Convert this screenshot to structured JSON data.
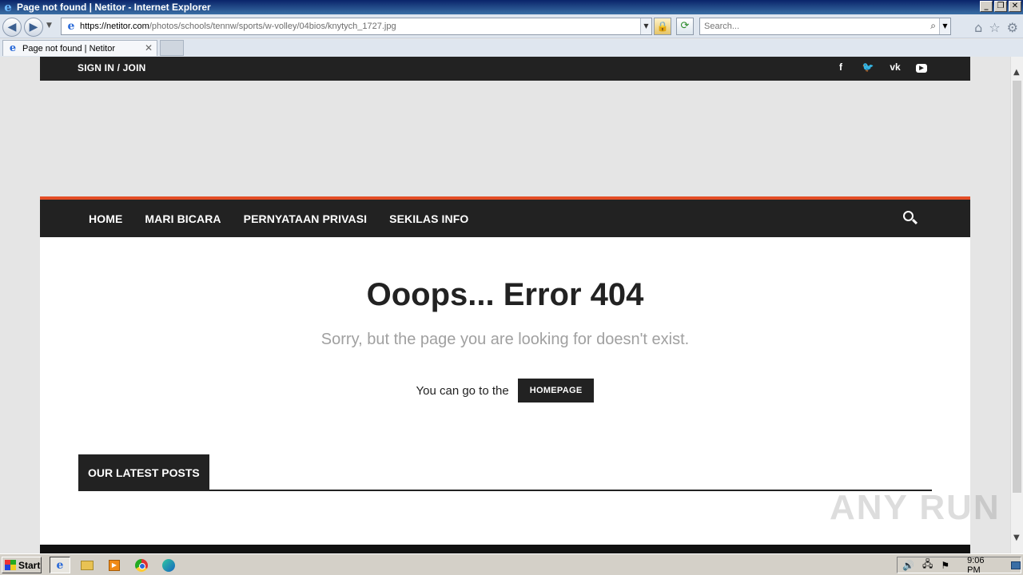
{
  "window": {
    "title": "Page not found | Netitor - Internet Explorer",
    "buttons": [
      "_",
      "❐",
      "✕"
    ]
  },
  "address_bar": {
    "url_host": "https://netitor.com",
    "url_path": "/photos/schools/tennw/sports/w-volley/04bios/knytych_1727.jpg",
    "search_placeholder": "Search..."
  },
  "tabs": [
    {
      "label": "Page not found | Netitor",
      "active": true
    }
  ],
  "site": {
    "topbar": {
      "signin_label": "SIGN IN / JOIN"
    },
    "social": [
      "facebook-icon",
      "twitter-icon",
      "vk-icon",
      "youtube-icon"
    ],
    "menu": [
      "HOME",
      "MARI BICARA",
      "PERNYATAAN PRIVASI",
      "SEKILAS INFO"
    ],
    "error": {
      "title": "Ooops... Error 404",
      "subtitle": "Sorry, but the page you are looking for doesn't exist.",
      "goto_text": "You can go to the",
      "homepage_button": "HOMEPAGE"
    },
    "latest_posts_label": "OUR LATEST POSTS",
    "accent_color": "#e44d26"
  },
  "watermark": "ANY RUN",
  "taskbar": {
    "start_label": "Start",
    "clock": "9:06 PM"
  }
}
